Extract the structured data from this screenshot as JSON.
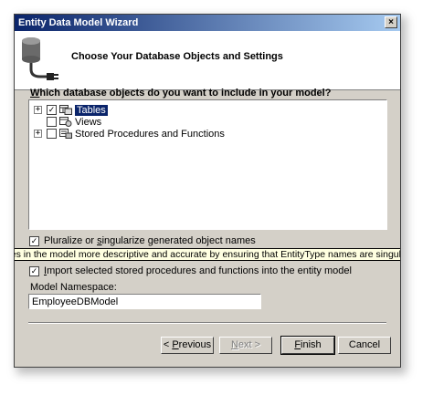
{
  "window": {
    "title": "Entity Data Model Wizard",
    "close_label": "×"
  },
  "header": {
    "title": "Choose Your Database Objects and Settings",
    "icon": "database-plug-icon"
  },
  "question": {
    "label_pre": "",
    "mnemonic": "W",
    "label_post": "hich database objects do you want to include in your model?"
  },
  "tree": {
    "items": [
      {
        "label": "Tables",
        "checked": true,
        "expander": "+",
        "selected": true
      },
      {
        "label": "Views",
        "checked": false,
        "expander": "",
        "selected": false
      },
      {
        "label": "Stored Procedures and Functions",
        "checked": false,
        "expander": "+",
        "selected": false
      }
    ]
  },
  "pluralize": {
    "checked": true,
    "label_pre": "Pluralize or ",
    "mnemonic": "s",
    "label_post": "ingularize generated object names"
  },
  "tooltip": {
    "text": "mes in the model more descriptive and accurate by ensuring that EntityType names are singular, EntitySet names"
  },
  "import_sp": {
    "checked": true,
    "label_pre": "",
    "mnemonic": "I",
    "label_post": "mport selected stored procedures and functions into the entity model"
  },
  "namespace": {
    "label": "Model Namespace:",
    "value": "EmployeeDBModel"
  },
  "buttons": {
    "previous": {
      "pre": "< ",
      "mnemonic": "P",
      "post": "revious"
    },
    "next": {
      "pre": "",
      "mnemonic": "N",
      "post": "ext >"
    },
    "finish": {
      "pre": "",
      "mnemonic": "F",
      "post": "inish"
    },
    "cancel": {
      "pre": "Cancel",
      "mnemonic": "",
      "post": ""
    }
  },
  "check_glyph": "✓"
}
